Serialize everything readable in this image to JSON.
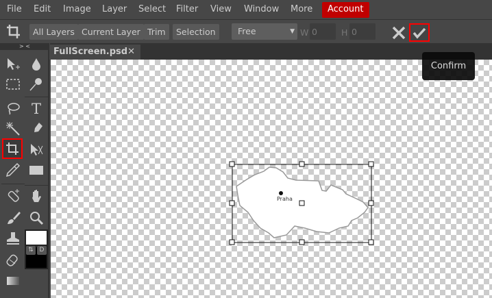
{
  "menu": [
    "File",
    "Edit",
    "Image",
    "Layer",
    "Select",
    "Filter",
    "View",
    "Window",
    "More",
    "Account"
  ],
  "options": {
    "buttons": [
      "All Layers",
      "Current Layer",
      "Trim",
      "Selection"
    ],
    "ratio": "Free",
    "w_label": "W",
    "w_value": "0",
    "h_label": "H",
    "h_value": "0"
  },
  "tab": {
    "title": "FullScreen.psd",
    "close": "✕"
  },
  "toolbox": {
    "collapse": "> <"
  },
  "tooltip": "Confirm",
  "map_label": "Praha",
  "colors": {
    "accent": "#c00000",
    "highlight": "#ff0000"
  }
}
